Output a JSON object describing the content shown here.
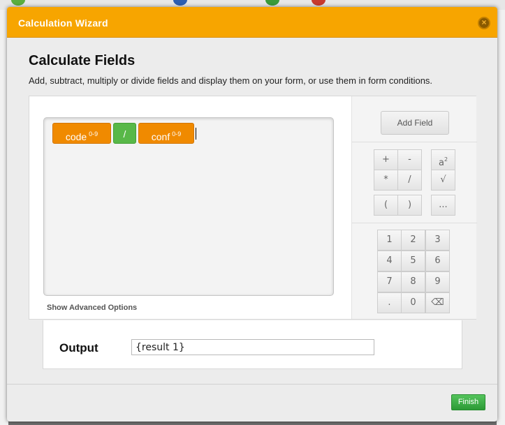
{
  "modal": {
    "title": "Calculation Wizard",
    "close_glyph": "×"
  },
  "heading": "Calculate Fields",
  "subheading": "Add, subtract, multiply or divide fields and display them on your form, or use them in form conditions.",
  "formula": {
    "tokens": [
      {
        "text": "code",
        "badge": "0-9",
        "kind": "field"
      },
      {
        "text": "/",
        "kind": "operator"
      },
      {
        "text": "conf",
        "badge": "0-9",
        "kind": "field"
      }
    ],
    "advanced_link": "Show Advanced Options"
  },
  "sidebar": {
    "add_field": "Add Field",
    "operators": [
      "+",
      "-",
      "*",
      "/",
      "(",
      ")"
    ],
    "power_base": "a",
    "power_exp": "2",
    "sqrt": "√",
    "more": "...",
    "digits": [
      "1",
      "2",
      "3",
      "4",
      "5",
      "6",
      "7",
      "8",
      "9",
      ".",
      "0"
    ],
    "backspace_glyph": "⌫"
  },
  "output": {
    "label": "Output",
    "value": "{result 1}"
  },
  "footer": {
    "finish": "Finish"
  },
  "colors": {
    "header": "#f7a500",
    "field_chip": "#f08a00",
    "operator_chip": "#58b848",
    "finish": "#2c9a36"
  }
}
